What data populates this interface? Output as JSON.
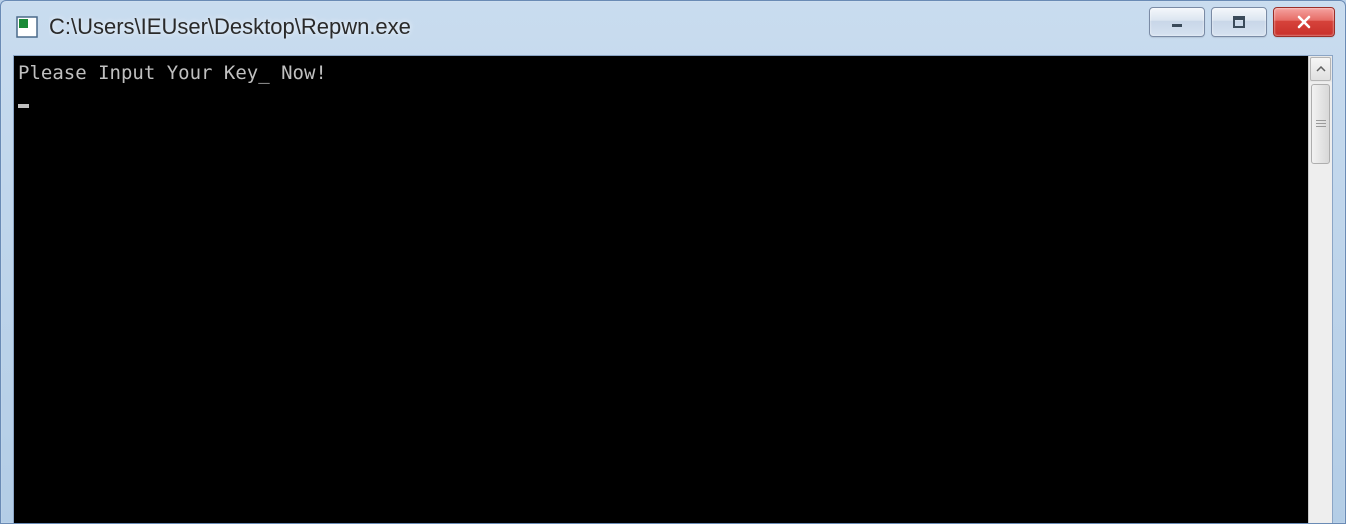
{
  "window": {
    "title": "C:\\Users\\IEUser\\Desktop\\Repwn.exe"
  },
  "console": {
    "line1": "Please Input Your Key_ Now!",
    "cursor": "_"
  },
  "controls": {
    "minimize": "minimize",
    "maximize": "maximize",
    "close": "close"
  }
}
